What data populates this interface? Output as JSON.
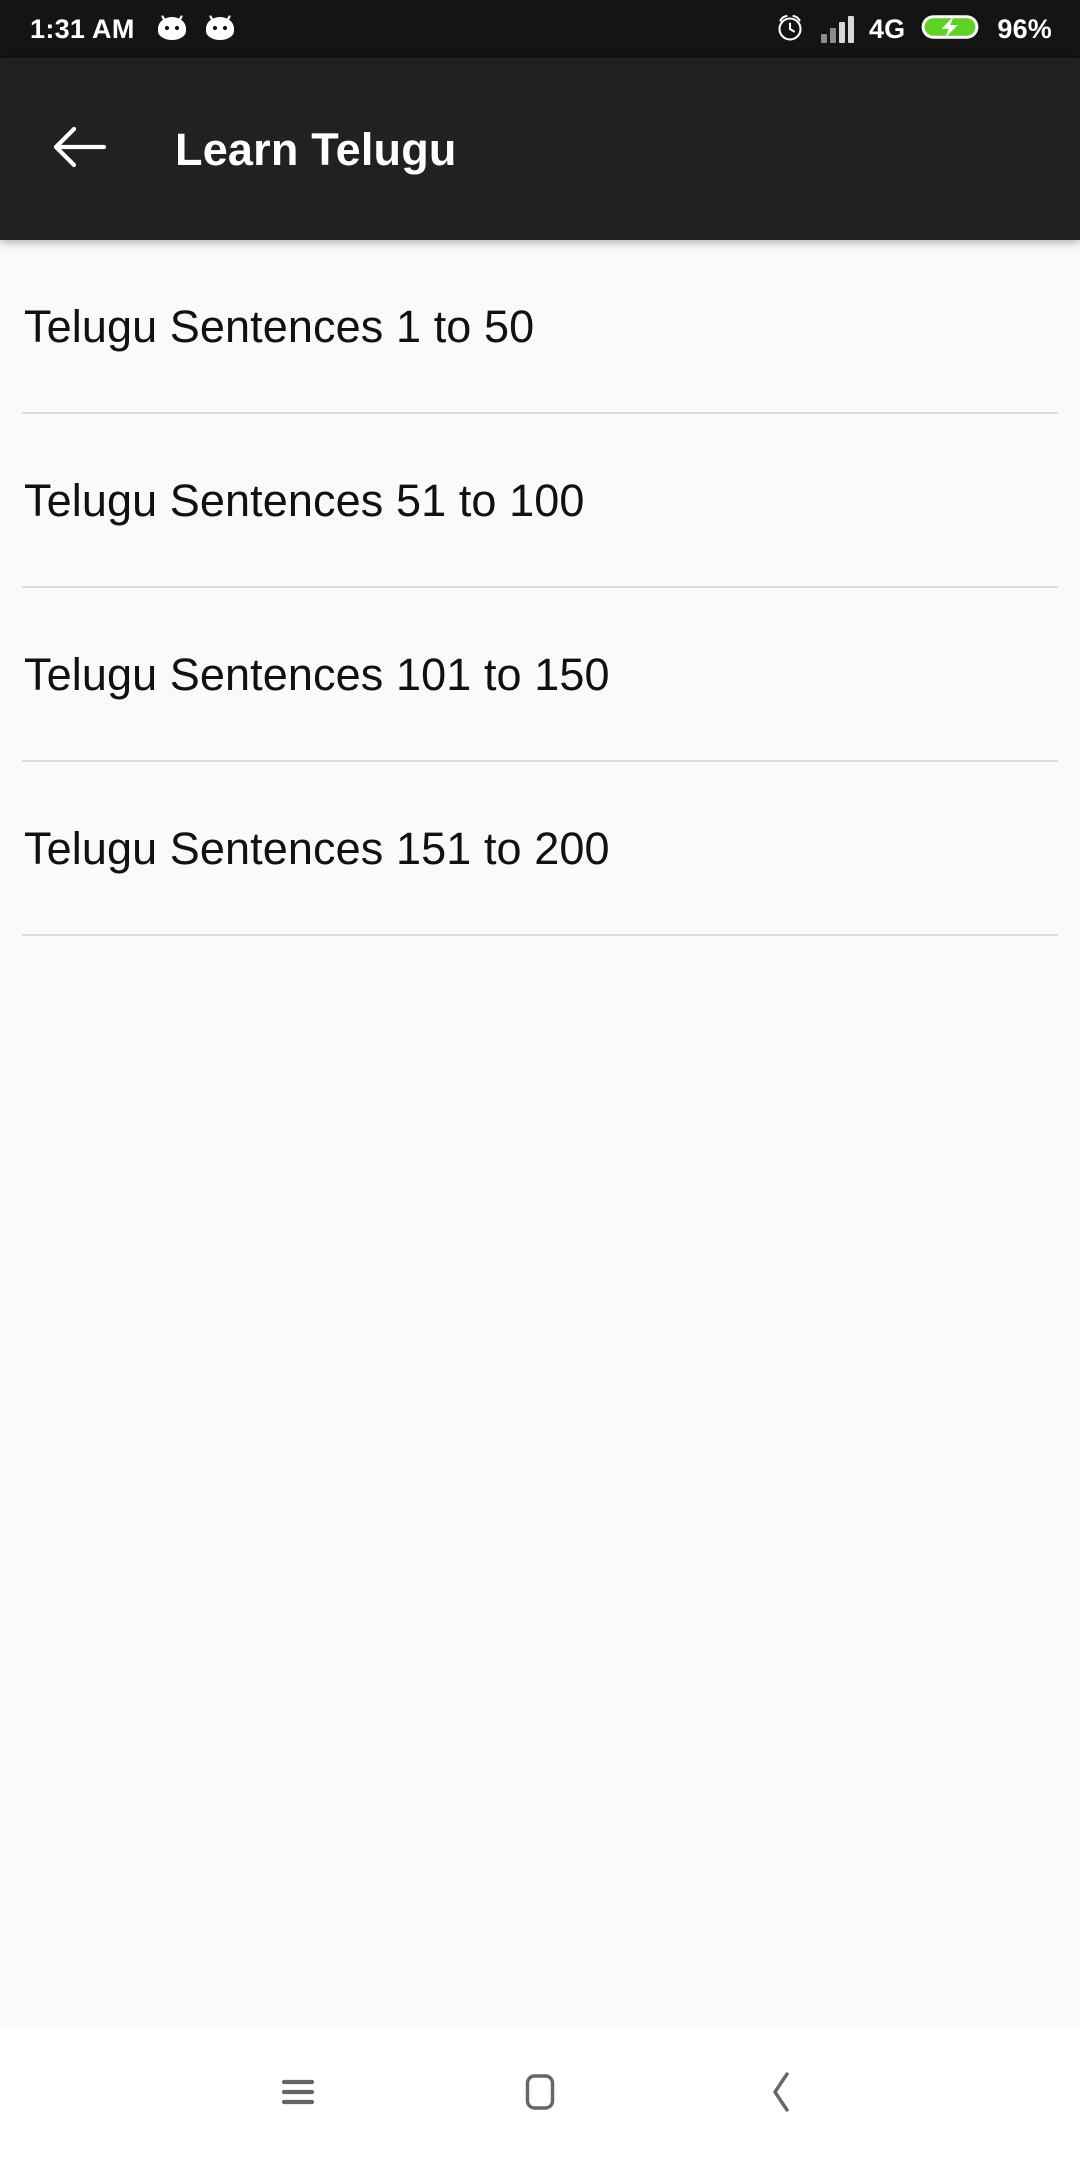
{
  "status_bar": {
    "time": "1:31 AM",
    "network_type": "4G",
    "battery_percent": "96%",
    "notification_icons": [
      "android-head-icon",
      "android-head-icon"
    ],
    "right_icons": [
      "alarm-clock-icon",
      "signal-bars-icon",
      "battery-charging-icon"
    ],
    "background_color": "#141414",
    "text_color": "#ffffff",
    "battery_color": "#5cd223",
    "signal_bars_filled": 2,
    "signal_bars_total": 4
  },
  "app_bar": {
    "title": "Learn Telugu",
    "back_icon": "arrow-left-icon",
    "background_color": "#212121",
    "title_color": "#ffffff"
  },
  "content": {
    "background_color": "#fafafa",
    "divider_color": "#dcdcdc",
    "list": [
      {
        "label": "Telugu Sentences 1 to 50"
      },
      {
        "label": "Telugu Sentences 51 to 100"
      },
      {
        "label": "Telugu Sentences 101 to 150"
      },
      {
        "label": "Telugu Sentences 151 to 200"
      }
    ]
  },
  "nav_bar": {
    "background_color": "#ffffff",
    "icon_color": "#666666",
    "buttons": [
      {
        "name": "recents",
        "icon": "hamburger-menu-icon"
      },
      {
        "name": "home",
        "icon": "rounded-square-icon"
      },
      {
        "name": "back",
        "icon": "chevron-left-icon"
      }
    ]
  }
}
